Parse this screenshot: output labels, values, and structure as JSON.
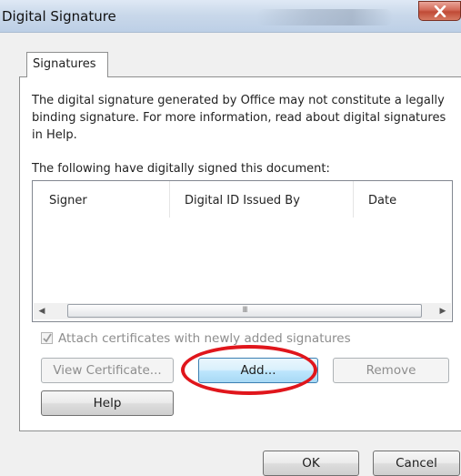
{
  "window": {
    "title": "Digital Signature",
    "close_icon": "close-icon"
  },
  "tabs": [
    {
      "label": "Signatures",
      "active": true
    }
  ],
  "info_text": "The digital signature generated by Office may not constitute a legally binding signature. For more information, read about digital signatures in Help.",
  "list_caption": "The following have digitally signed this document:",
  "list": {
    "columns": [
      "Signer",
      "Digital ID Issued By",
      "Date"
    ],
    "rows": [],
    "scrollbar_thumb_grip": "III"
  },
  "attach_checkbox": {
    "label": "Attach certificates with newly added signatures",
    "checked": true,
    "enabled": false
  },
  "buttons": {
    "view_certificate": "View Certificate...",
    "add": "Add...",
    "remove": "Remove",
    "help": "Help",
    "ok": "OK",
    "cancel": "Cancel"
  },
  "annotation": {
    "highlight_color": "#e0161c",
    "highlight_target": "Add..."
  }
}
